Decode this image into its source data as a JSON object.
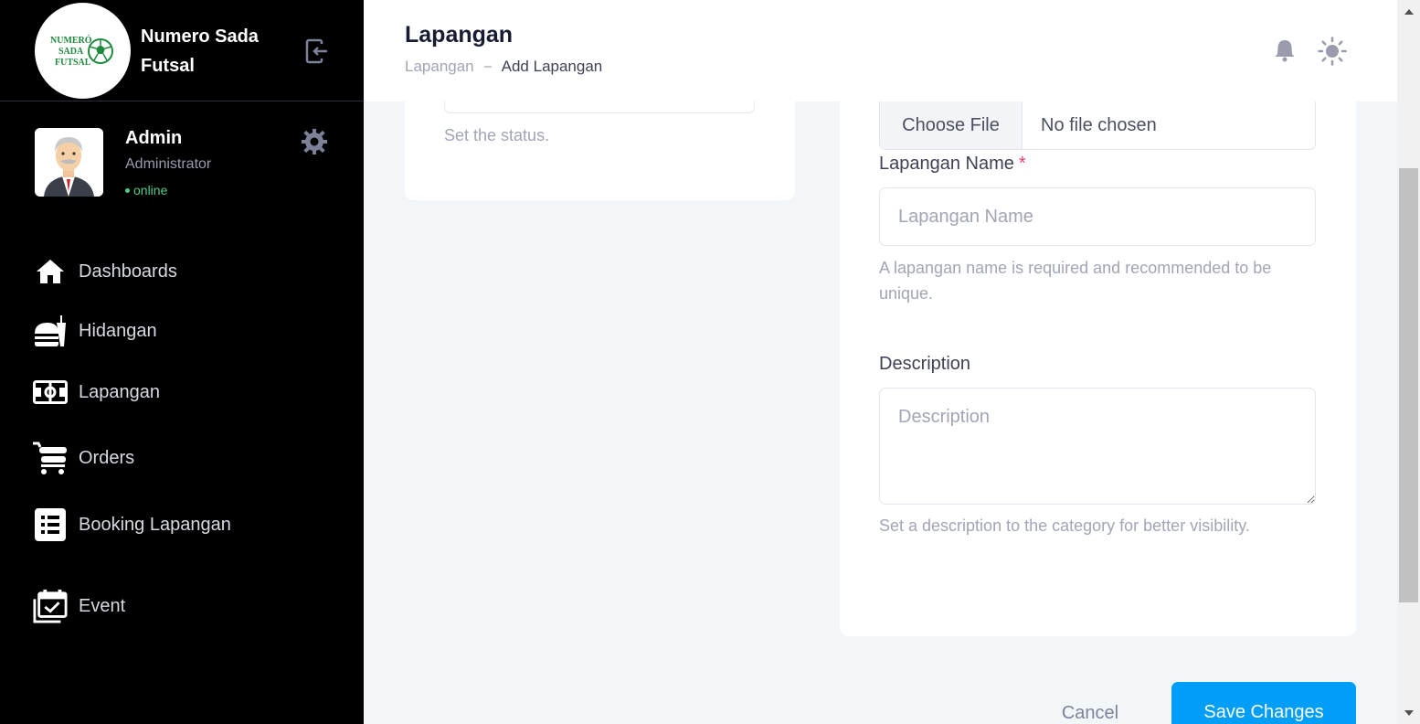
{
  "brand": {
    "name": "Numero Sada Futsal",
    "logo_text": "NUMERÓ SADA FUTSAL"
  },
  "user": {
    "name": "Admin",
    "role": "Administrator",
    "status": "online"
  },
  "menu": [
    {
      "label": "Dashboards",
      "icon": "home-icon"
    },
    {
      "label": "Hidangan",
      "icon": "food-icon"
    },
    {
      "label": "Lapangan",
      "icon": "field-icon"
    },
    {
      "label": "Orders",
      "icon": "cart-icon"
    },
    {
      "label": "Booking Lapangan",
      "icon": "list-icon"
    },
    {
      "label": "Event",
      "icon": "calendar-check-icon"
    }
  ],
  "header": {
    "title": "Lapangan",
    "breadcrumb": [
      "Lapangan",
      "Add Lapangan"
    ]
  },
  "status_card": {
    "help": "Set the status."
  },
  "form": {
    "file_button": "Choose File",
    "file_status": "No file chosen",
    "name_label": "Lapangan Name",
    "name_required_mark": "*",
    "name_placeholder": "Lapangan Name",
    "name_help": "A lapangan name is required and recommended to be unique.",
    "desc_label": "Description",
    "desc_placeholder": "Description",
    "desc_help": "Set a description to the category for better visibility."
  },
  "actions": {
    "cancel": "Cancel",
    "save": "Save Changes"
  },
  "colors": {
    "sidebar_bg": "#000000",
    "primary": "#009ef7",
    "online": "#50cd89",
    "required": "#f1416c"
  }
}
